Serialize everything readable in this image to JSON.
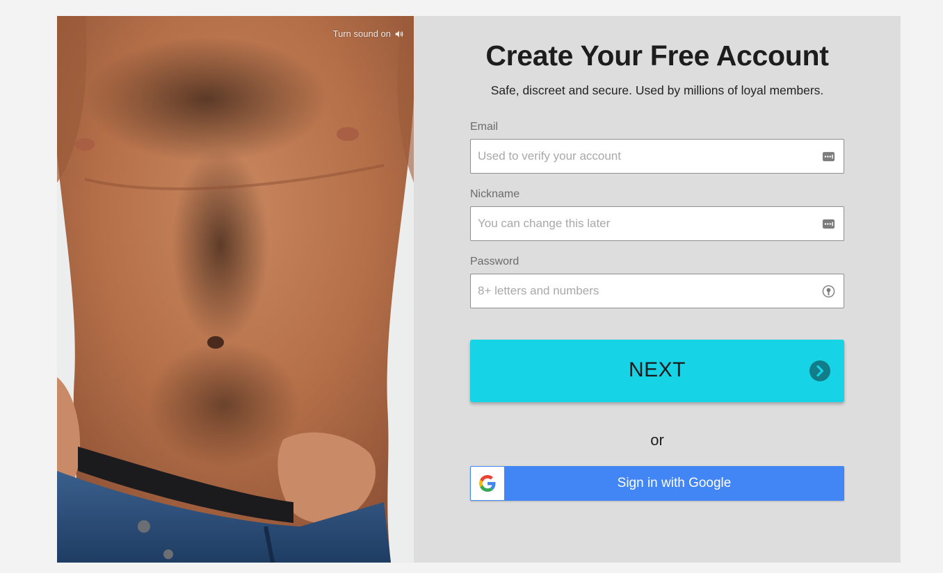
{
  "media": {
    "sound_toggle_label": "Turn sound on",
    "sound_icon": "speaker-icon"
  },
  "form": {
    "title": "Create Your Free Account",
    "subtitle": "Safe, discreet and secure. Used by millions of loyal members.",
    "fields": [
      {
        "label": "Email",
        "placeholder": "Used to verify your account",
        "value": "",
        "icon": "password-manager-icon"
      },
      {
        "label": "Nickname",
        "placeholder": "You can change this later",
        "value": "",
        "icon": "password-manager-icon"
      },
      {
        "label": "Password",
        "placeholder": "8+ letters and numbers",
        "value": "",
        "icon": "key-icon"
      }
    ],
    "next_label": "NEXT",
    "next_icon": "chevron-right-circle-icon",
    "or_label": "or",
    "google_label": "Sign in with Google",
    "google_icon": "google-g-icon"
  },
  "colors": {
    "page_background": "#f3f3f3",
    "panel_background": "#dddddd",
    "next_button": "#17d3e6",
    "next_arrow": "#127c89",
    "google_button": "#4286f5"
  }
}
